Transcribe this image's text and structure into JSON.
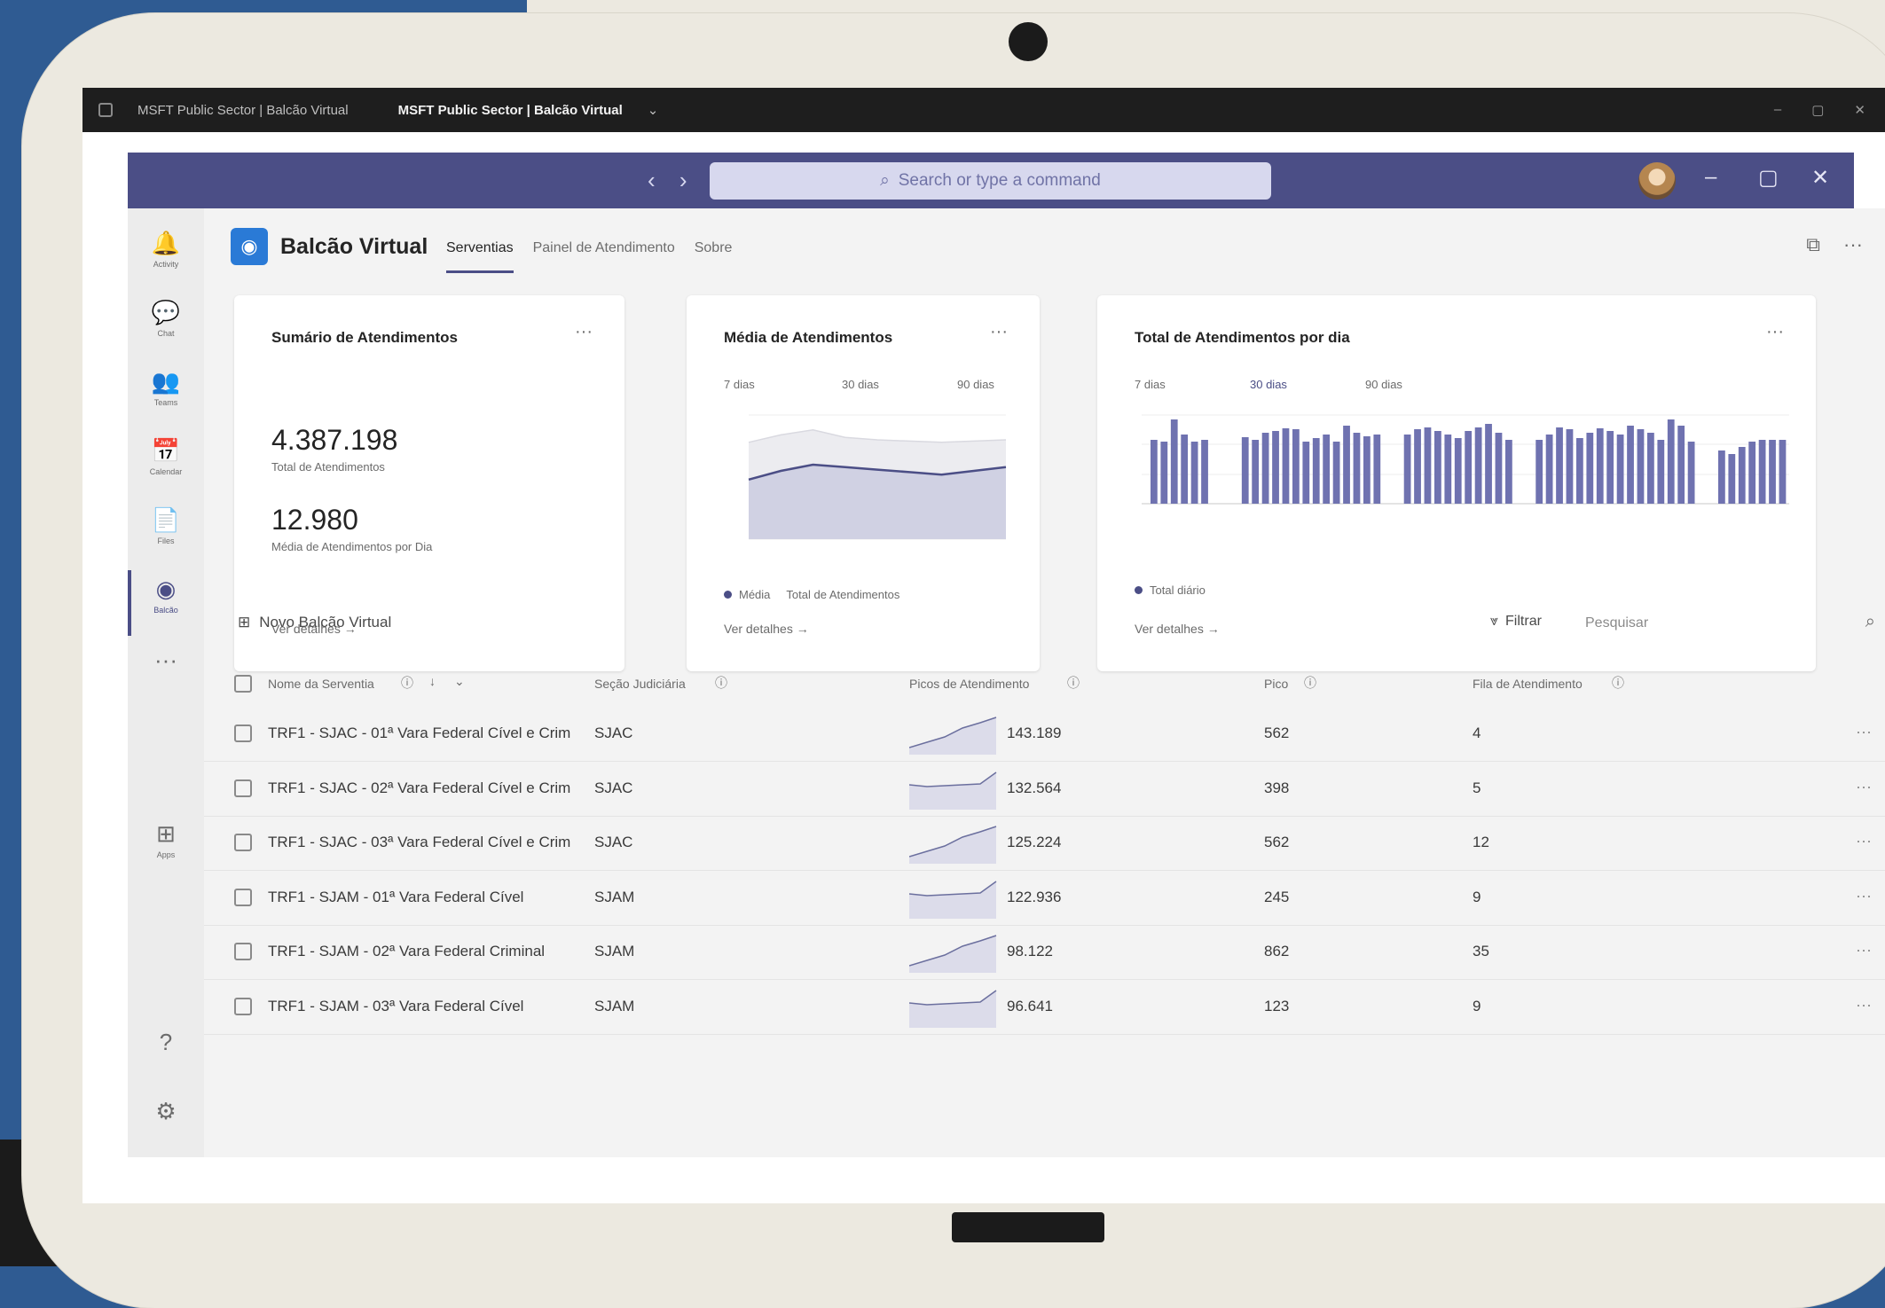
{
  "browser": {
    "tabs": [
      {
        "label": "MSFT Public Sector | Balcão Virtual",
        "active": false
      },
      {
        "label": "MSFT Public Sector | Balcão Virtual",
        "active": true
      }
    ]
  },
  "teams": {
    "search_placeholder": "Search or type a command",
    "nav_arrows": "‹ ›"
  },
  "left_nav": [
    {
      "icon": "bell-icon",
      "glyph": "🔔",
      "label": "Activity"
    },
    {
      "icon": "chat-icon",
      "glyph": "💬",
      "label": "Chat"
    },
    {
      "icon": "teams-icon",
      "glyph": "👥",
      "label": "Teams"
    },
    {
      "icon": "calendar-icon",
      "glyph": "📅",
      "label": "Calendar"
    },
    {
      "icon": "files-icon",
      "glyph": "📄",
      "label": "Files"
    },
    {
      "icon": "app-icon",
      "glyph": "◉",
      "label": "Balcão"
    },
    {
      "icon": "more-icon",
      "glyph": "···",
      "label": ""
    },
    {
      "icon": "apps-icon",
      "glyph": "⊞",
      "label": "Apps"
    },
    {
      "icon": "help-icon",
      "glyph": "?",
      "label": ""
    },
    {
      "icon": "settings-icon",
      "glyph": "⚙",
      "label": ""
    }
  ],
  "app": {
    "title": "Balcão Virtual",
    "tabs": [
      "Serventias",
      "Painel de Atendimento",
      "Sobre"
    ]
  },
  "summary_card": {
    "title": "Sumário de Atendimentos",
    "total_value": "4.387.198",
    "total_label": "Total de Atendimentos",
    "avg_value": "12.980",
    "avg_label": "Média de Atendimentos por Dia",
    "link": "Ver detalhes →"
  },
  "avg_card": {
    "title": "Média de Atendimentos",
    "ranges": [
      "7 dias",
      "30 dias",
      "90 dias"
    ],
    "legend": [
      "Média",
      "Total de Atendimentos"
    ],
    "link": "Ver detalhes →"
  },
  "daily_card": {
    "title": "Total de Atendimentos por dia",
    "ranges": [
      "7 dias",
      "30 dias",
      "90 dias"
    ],
    "legend": "Total diário",
    "link": "Ver detalhes →"
  },
  "toolbar": {
    "new_label": "Novo Balcão Virtual",
    "filter_label": "Filtrar",
    "search_placeholder": "Pesquisar"
  },
  "grid": {
    "columns": [
      "Nome da Serventia",
      "Seção Judiciária",
      "Picos de Atendimento",
      "Pico",
      "Fila de Atendimento"
    ],
    "rows": [
      {
        "name": "TRF1 - SJAC - 01ª Vara Federal Cível e Crim",
        "secao": "SJAC",
        "value": "143.189",
        "pico": "562",
        "fila": "4"
      },
      {
        "name": "TRF1 - SJAC - 02ª Vara Federal Cível e Crim",
        "secao": "SJAC",
        "value": "132.564",
        "pico": "398",
        "fila": "5"
      },
      {
        "name": "TRF1 - SJAC - 03ª Vara Federal Cível e Crim",
        "secao": "SJAC",
        "value": "125.224",
        "pico": "562",
        "fila": "12"
      },
      {
        "name": "TRF1 - SJAM - 01ª Vara Federal Cível",
        "secao": "SJAM",
        "value": "122.936",
        "pico": "245",
        "fila": "9"
      },
      {
        "name": "TRF1 - SJAM - 02ª Vara Federal Criminal",
        "secao": "SJAM",
        "value": "98.122",
        "pico": "862",
        "fila": "35"
      },
      {
        "name": "TRF1 - SJAM - 03ª Vara Federal Cível",
        "secao": "SJAM",
        "value": "96.641",
        "pico": "123",
        "fila": "9"
      }
    ]
  },
  "chart_data": [
    {
      "type": "area",
      "title": "Média de Atendimentos",
      "series": [
        {
          "name": "Total de Atendimentos",
          "values": [
            78,
            84,
            88,
            82,
            80,
            79,
            78,
            79,
            80
          ]
        },
        {
          "name": "Média",
          "values": [
            48,
            55,
            60,
            58,
            56,
            54,
            52,
            55,
            58
          ]
        }
      ]
    },
    {
      "type": "bar",
      "title": "Total de Atendimentos por dia",
      "series": [
        {
          "name": "Total diário",
          "values": [
            72,
            70,
            95,
            78,
            70,
            72,
            0,
            0,
            0,
            75,
            72,
            80,
            82,
            85,
            84,
            70,
            74,
            78,
            70,
            88,
            80,
            76,
            78,
            0,
            0,
            78,
            84,
            86,
            82,
            78,
            74,
            82,
            86,
            90,
            80,
            72,
            0,
            0,
            72,
            78,
            86,
            84,
            74,
            80,
            85,
            82,
            78,
            88,
            84,
            80,
            72,
            95,
            88,
            70,
            0,
            0,
            60,
            56,
            64,
            70,
            72,
            72,
            72
          ]
        }
      ]
    }
  ]
}
